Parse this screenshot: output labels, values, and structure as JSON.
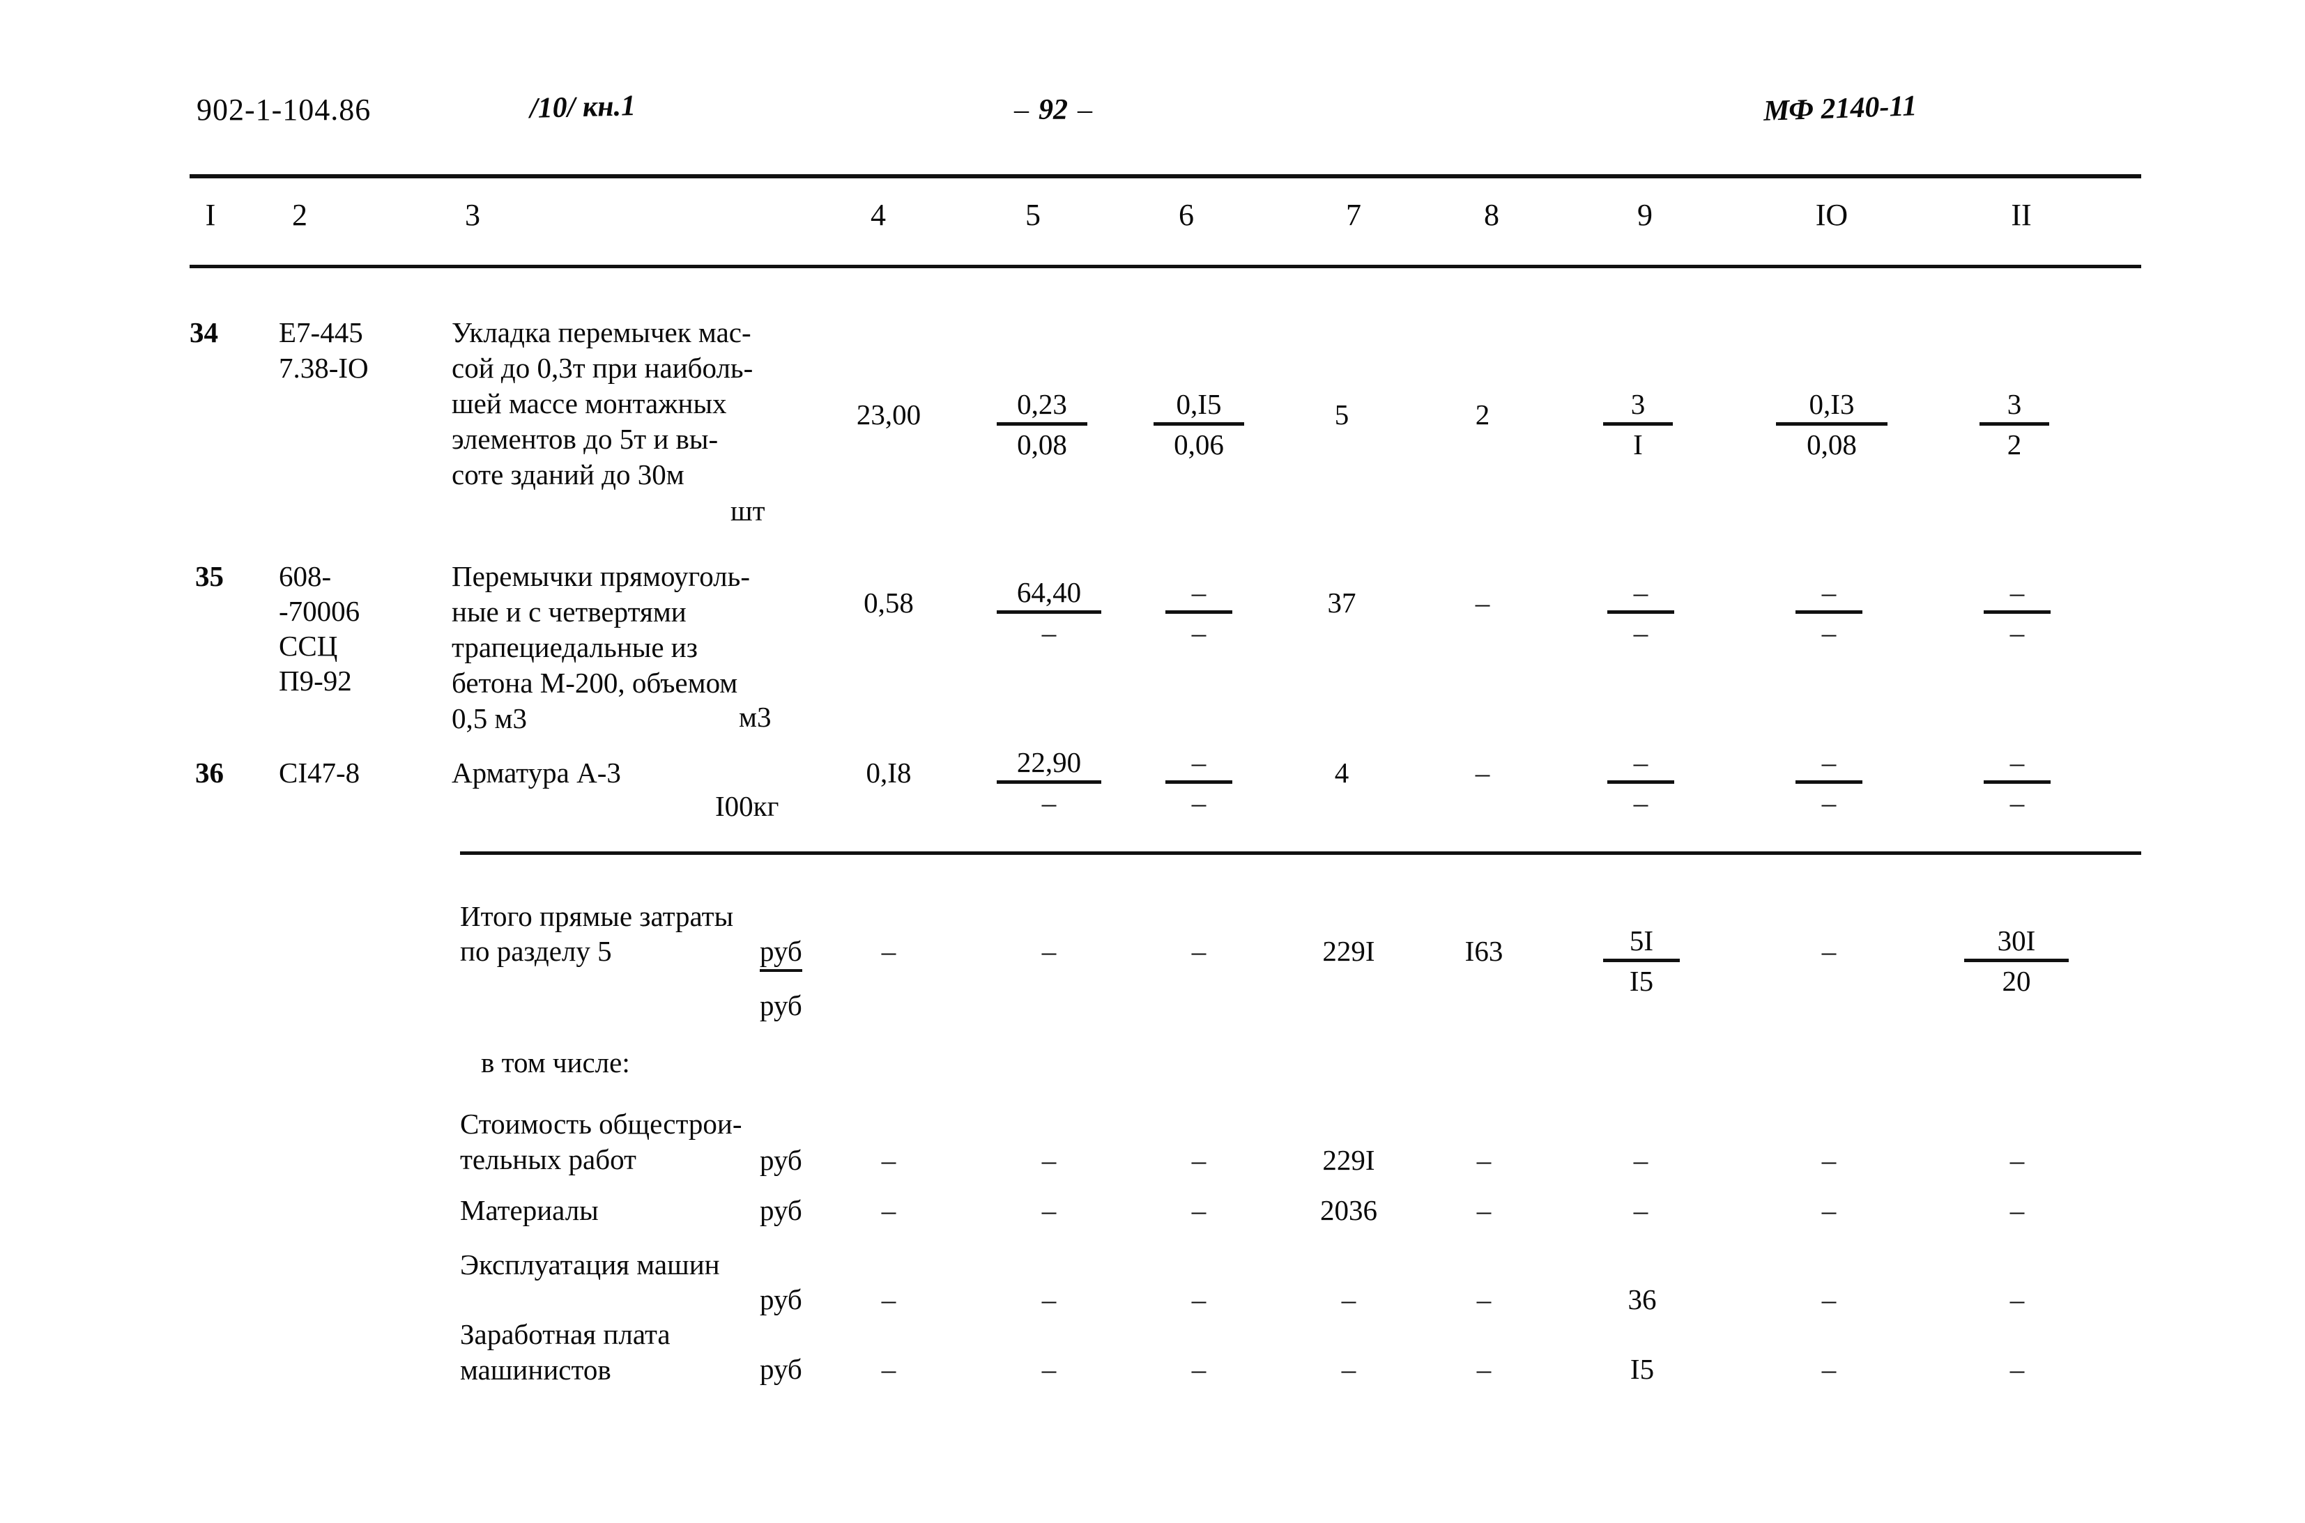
{
  "header": {
    "doc_code": "902-1-104.86",
    "volume": "/10/ кн.1",
    "page_dash_left": "–",
    "page_number": "92",
    "page_dash_right": "–",
    "stamp": "МФ 2140-11"
  },
  "column_headers": [
    "I",
    "2",
    "3",
    "4",
    "5",
    "6",
    "7",
    "8",
    "9",
    "IO",
    "II"
  ],
  "rows": [
    {
      "no": "34",
      "code_lines": [
        "Е7-445",
        "7.38-IO"
      ],
      "description": "Укладка перемычек мас-\nсой до 0,3т при наиболь-\nшей массе монтажных\nэлементов до 5т и вы-\nсоте зданий до 30м",
      "unit": "шт",
      "col4": "23,00",
      "col5": {
        "top": "0,23",
        "bot": "0,08"
      },
      "col6": {
        "top": "0,I5",
        "bot": "0,06"
      },
      "col7": "5",
      "col8": "2",
      "col9": {
        "top": "3",
        "bot": "I"
      },
      "col10": {
        "top": "0,I3",
        "bot": "0,08"
      },
      "col11": {
        "top": "3",
        "bot": "2"
      }
    },
    {
      "no": "35",
      "code_lines": [
        "608-",
        "-70006",
        "ССЦ",
        "П9-92"
      ],
      "description": "Перемычки прямоуголь-\nные и с четвертями\nтрапециедальные из\nбетона М-200, объемом\n0,5 м3",
      "unit": "м3",
      "col4": "0,58",
      "col5": {
        "top": "64,40",
        "bot": "–"
      },
      "col6": {
        "top": "–",
        "bot": "–"
      },
      "col7": "37",
      "col8": "–",
      "col9": {
        "top": "–",
        "bot": "–"
      },
      "col10": {
        "top": "–",
        "bot": "–"
      },
      "col11": {
        "top": "–",
        "bot": "–"
      }
    },
    {
      "no": "36",
      "code_lines": [
        "СI47-8"
      ],
      "description": "Арматура А-3",
      "unit": "I00кг",
      "col4": "0,I8",
      "col5": {
        "top": "22,90",
        "bot": "–"
      },
      "col6": {
        "top": "–",
        "bot": "–"
      },
      "col7": "4",
      "col8": "–",
      "col9": {
        "top": "–",
        "bot": "–"
      },
      "col10": {
        "top": "–",
        "bot": "–"
      },
      "col11": {
        "top": "–",
        "bot": "–"
      }
    }
  ],
  "totals": {
    "label_line1": "Итого прямые затраты",
    "label_line2": "по разделу 5",
    "unit_top": "руб",
    "unit_bot": "руб",
    "col4": "–",
    "col5": "–",
    "col6": "–",
    "col7": "229I",
    "col8": "I63",
    "col9": {
      "top": "5I",
      "bot": "I5"
    },
    "col10": "–",
    "col11": {
      "top": "30I",
      "bot": "20"
    }
  },
  "breakdown_label": "в том числе:",
  "breakdown": [
    {
      "label": "Стоимость общестрои-\nтельных работ",
      "unit": "руб",
      "col4": "–",
      "col5": "–",
      "col6": "–",
      "col7": "229I",
      "col8": "–",
      "col9": "–",
      "col10": "–",
      "col11": "–"
    },
    {
      "label": "Материалы",
      "unit": "руб",
      "col4": "–",
      "col5": "–",
      "col6": "–",
      "col7": "2036",
      "col8": "–",
      "col9": "–",
      "col10": "–",
      "col11": "–"
    },
    {
      "label": "Эксплуатация машин",
      "unit": "руб",
      "col4": "–",
      "col5": "–",
      "col6": "–",
      "col7": "–",
      "col8": "–",
      "col9": "36",
      "col10": "–",
      "col11": "–"
    },
    {
      "label": "Заработная плата\nмашинистов",
      "unit": "руб",
      "col4": "–",
      "col5": "–",
      "col6": "–",
      "col7": "–",
      "col8": "–",
      "col9": "I5",
      "col10": "–",
      "col11": "–"
    }
  ]
}
